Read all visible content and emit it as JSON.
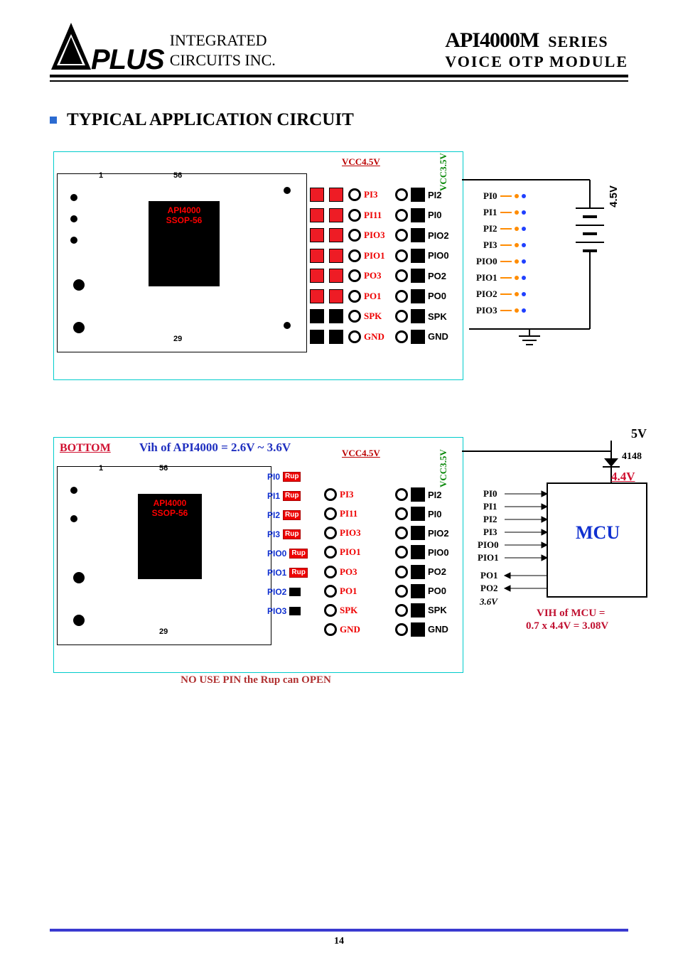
{
  "header": {
    "logo_text": "PLUS",
    "company_line1": "INTEGRATED",
    "company_line2": "CIRCUITS  INC.",
    "series_main": "API4000M",
    "series_suffix": "SERIES",
    "subtitle": "VOICE  OTP  MODULE"
  },
  "section_heading": "TYPICAL APPLICATION CIRCUIT",
  "figure1": {
    "pcb_chip_line1": "API4000",
    "pcb_chip_line2": "SSOP-56",
    "pin_1": "1",
    "pin_56": "56",
    "pin_29": "29",
    "vcc45": "VCC4.5V",
    "vcc35": "VCC3.5V",
    "col1_labels": [
      "PI3",
      "PI11",
      "PIO3",
      "PIO1",
      "PO3",
      "PO1",
      "SPK",
      "GND"
    ],
    "col2_labels": [
      "PI2",
      "PI0",
      "PIO2",
      "PIO0",
      "PO2",
      "PO0",
      "SPK",
      "GND"
    ]
  },
  "ext1": {
    "voltage": "4.5V",
    "pins": [
      "PI0",
      "PI1",
      "PI2",
      "PI3",
      "PIO0",
      "PIO1",
      "PIO2",
      "PIO3"
    ]
  },
  "figure2": {
    "vih_line": "Vih of API4000 = 2.6V ~ 3.6V",
    "bottom_label": "BOTTOM",
    "vcc45": "VCC4.5V",
    "vcc35": "VCC3.5V",
    "pin_1": "1",
    "pin_56": "56",
    "pin_29": "29",
    "left_blue": [
      "PI0",
      "PI1",
      "PI2",
      "PI3",
      "PIO0",
      "PIO1",
      "PIO2",
      "PIO3"
    ],
    "rup": "Rup",
    "col1_labels": [
      "PI3",
      "PI11",
      "PIO3",
      "PIO1",
      "PO3",
      "PO1",
      "SPK",
      "GND"
    ],
    "col2_labels": [
      "PI2",
      "PI0",
      "PIO2",
      "PIO0",
      "PO2",
      "PO0",
      "SPK",
      "GND"
    ]
  },
  "ext2": {
    "v5": "5V",
    "diode": "4148",
    "v44": "4.4V",
    "mcu": "MCU",
    "vih_mcu_l1": "VIH of MCU =",
    "vih_mcu_l2": "0.7 x 4.4V = 3.08V",
    "v36": "3.6V",
    "pins_in": [
      "PI0",
      "PI1",
      "PI2",
      "PI3",
      "PIO0",
      "PIO1"
    ],
    "pins_out": [
      "PO1",
      "PO2"
    ]
  },
  "caption2": "NO USE PIN the Rup can OPEN",
  "page_number": "14"
}
